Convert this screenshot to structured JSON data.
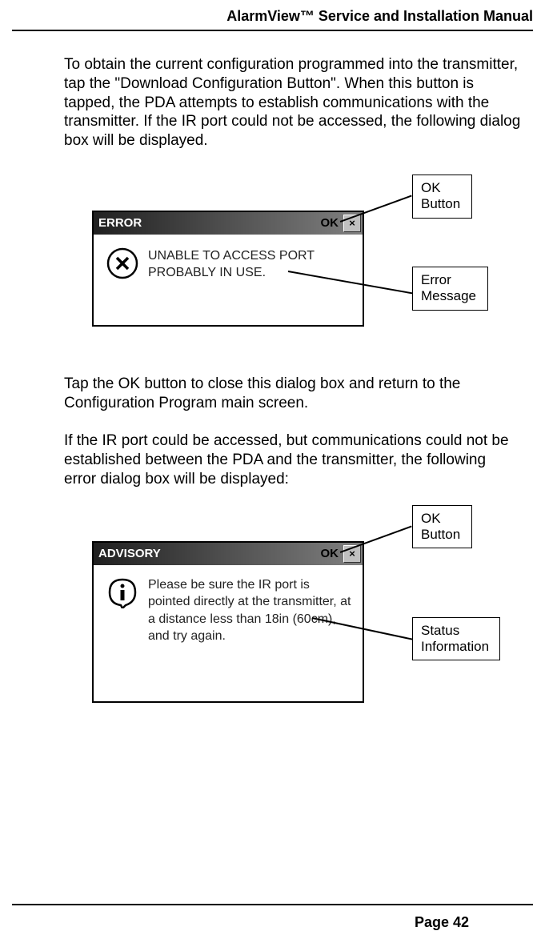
{
  "header": "AlarmView™ Service and Installation Manual",
  "para1": "To obtain the current configuration programmed into the transmitter, tap the \"Download Configuration Button\".  When this button is tapped, the PDA attempts to establish communications with the transmitter.  If the IR port could not be accessed, the following dialog box will be displayed.",
  "figure1": {
    "title": "ERROR",
    "ok": "OK",
    "close": "×",
    "message": "UNABLE TO ACCESS PORT PROBABLY IN USE.",
    "callout_ok": "OK Button",
    "callout_msg": "Error Message"
  },
  "para2": "Tap the OK button to close this dialog box and return to the Configuration Program main screen.",
  "para3": "If the IR port could be accessed, but communications could not be established between the PDA and the transmitter, the following error dialog box will be displayed:",
  "figure2": {
    "title": "ADVISORY",
    "ok": "OK",
    "close": "×",
    "message": "Please be sure the IR port is pointed directly at the transmitter, at a distance less than 18in (60cm), and try again.",
    "callout_ok": "OK Button",
    "callout_msg": "Status Information"
  },
  "footer": "Page 42"
}
